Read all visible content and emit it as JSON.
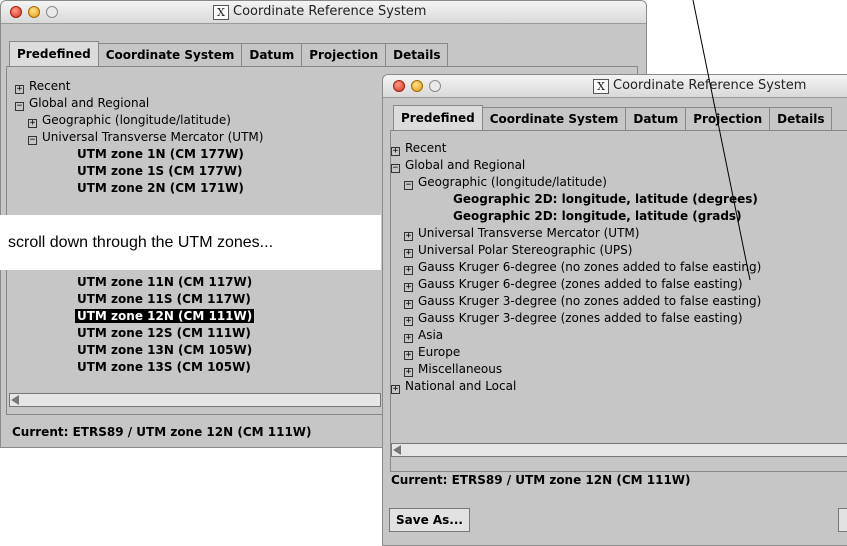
{
  "window_back": {
    "title": "Coordinate Reference System",
    "tabs": [
      "Predefined",
      "Coordinate System",
      "Datum",
      "Projection",
      "Details"
    ],
    "tree_top": [
      {
        "label": "Recent",
        "expander": "+",
        "indent": 0
      },
      {
        "label": "Global and Regional",
        "expander": "-",
        "indent": 0
      },
      {
        "label": "Geographic (longitude/latitude)",
        "expander": "+",
        "indent": 1
      },
      {
        "label": "Universal Transverse Mercator (UTM)",
        "expander": "-",
        "indent": 1
      },
      {
        "label": "UTM zone 1N (CM 177W)",
        "expander": "",
        "indent": 2
      },
      {
        "label": "UTM zone 1S (CM 177W)",
        "expander": "",
        "indent": 2
      },
      {
        "label": "UTM zone 2N (CM 171W)",
        "expander": "",
        "indent": 2
      }
    ],
    "tree_bottom": [
      {
        "label": "UTM zone 11N (CM 117W)"
      },
      {
        "label": "UTM zone 11S (CM 117W)"
      },
      {
        "label": "UTM zone 12N (CM 111W)",
        "selected": true
      },
      {
        "label": "UTM zone 12S (CM 111W)"
      },
      {
        "label": "UTM zone 13N (CM 105W)"
      },
      {
        "label": "UTM zone 13S (CM 105W)"
      }
    ],
    "current": "Current: ETRS89 / UTM zone 12N (CM 111W)"
  },
  "caption": "scroll down through the UTM zones...",
  "window_front": {
    "title": "Coordinate Reference System",
    "tabs": [
      "Predefined",
      "Coordinate System",
      "Datum",
      "Projection",
      "Details"
    ],
    "tree": [
      {
        "label": "Recent",
        "expander": "+",
        "indent": 0
      },
      {
        "label": "Global and Regional",
        "expander": "-",
        "indent": 0
      },
      {
        "label": "Geographic (longitude/latitude)",
        "expander": "-",
        "indent": 1
      },
      {
        "label": "Geographic 2D: longitude, latitude (degrees)",
        "expander": "",
        "indent": 2
      },
      {
        "label": "Geographic 2D: longitude, latitude (grads)",
        "expander": "",
        "indent": 2
      },
      {
        "label": "Universal Transverse Mercator (UTM)",
        "expander": "+",
        "indent": 1
      },
      {
        "label": "Universal Polar Stereographic (UPS)",
        "expander": "+",
        "indent": 1
      },
      {
        "label": "Gauss Kruger 6-degree (no zones added to false easting)",
        "expander": "+",
        "indent": 1
      },
      {
        "label": "Gauss Kruger 6-degree (zones added to false easting)",
        "expander": "+",
        "indent": 1
      },
      {
        "label": "Gauss Kruger 3-degree (no zones added to false easting)",
        "expander": "+",
        "indent": 1
      },
      {
        "label": "Gauss Kruger 3-degree (zones added to false easting)",
        "expander": "+",
        "indent": 1
      },
      {
        "label": "Asia",
        "expander": "+",
        "indent": 1
      },
      {
        "label": "Europe",
        "expander": "+",
        "indent": 1
      },
      {
        "label": "Miscellaneous",
        "expander": "+",
        "indent": 1
      },
      {
        "label": "National and Local",
        "expander": "+",
        "indent": 0
      }
    ],
    "current": "Current: ETRS89 / UTM zone 12N (CM 111W)",
    "save_as": "Save As..."
  }
}
